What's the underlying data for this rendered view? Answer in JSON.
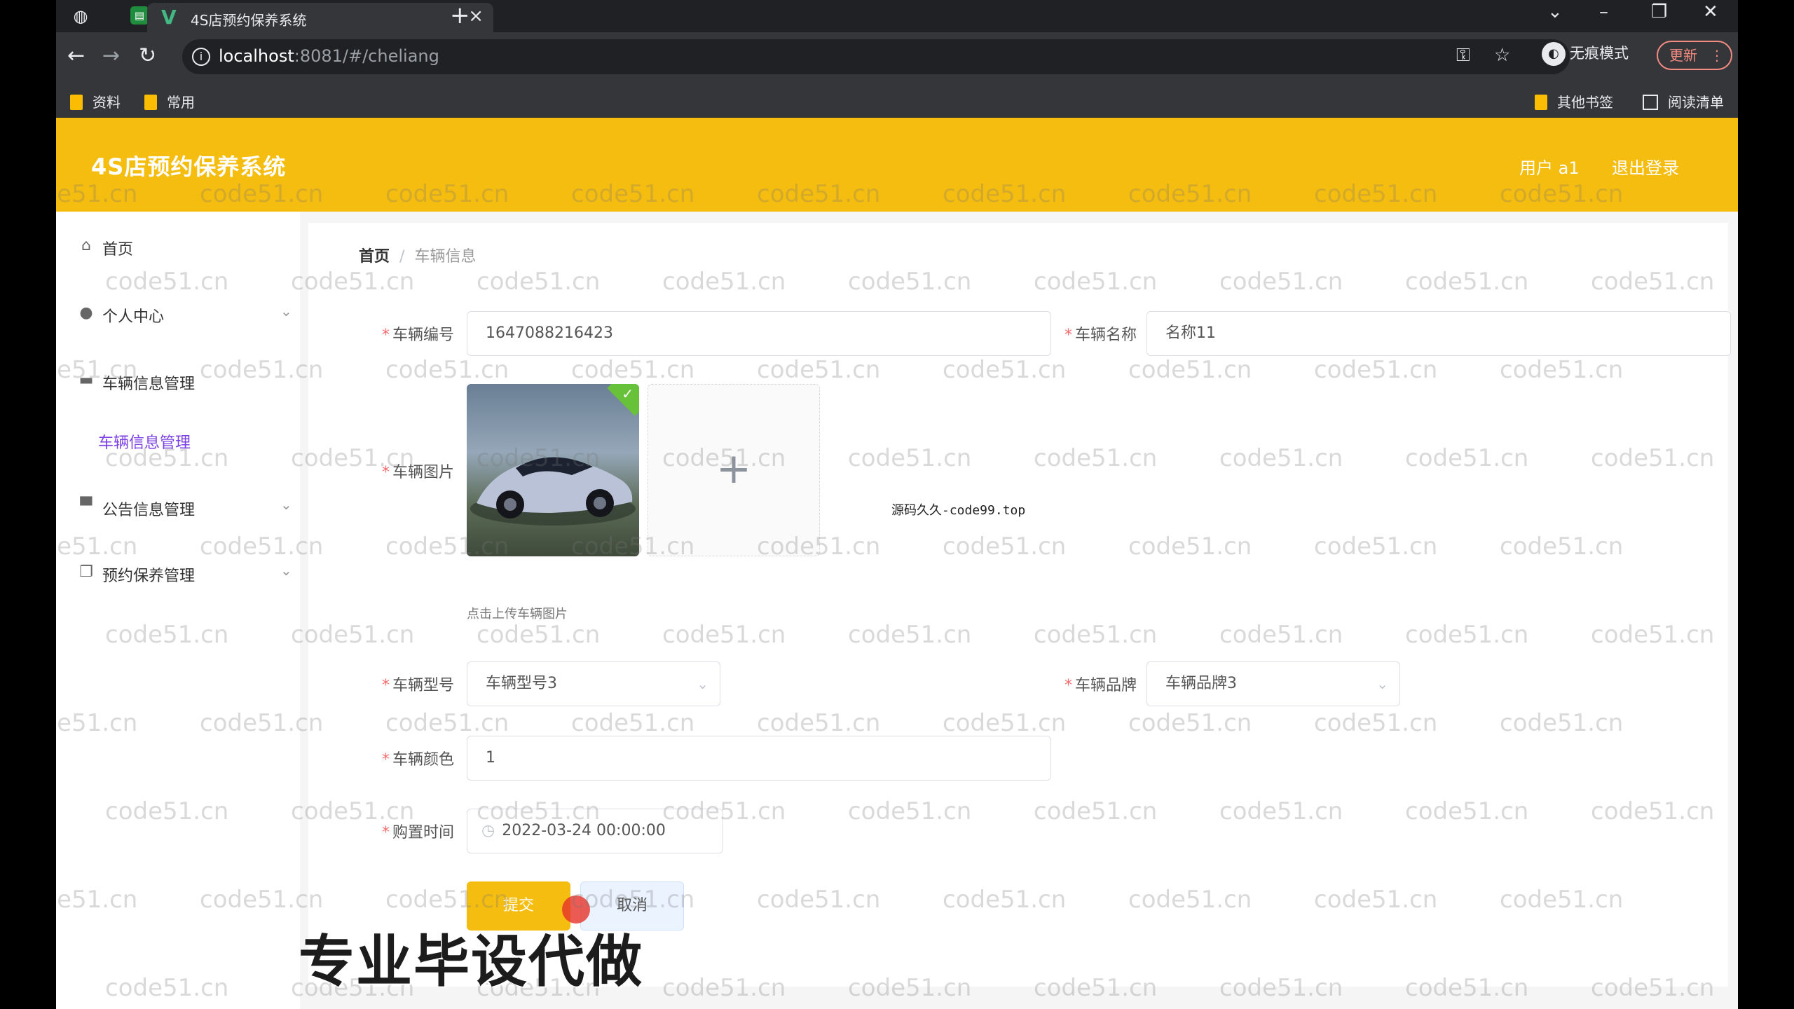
{
  "browser": {
    "tab_title": "4S店预约保养系统",
    "tab_close": "×",
    "new_tab": "+",
    "url_host": "localhost",
    "url_path": ":8081/#/cheliang",
    "incognito_label": "无痕模式",
    "update_label": "更新",
    "bookmarks": [
      "资料",
      "常用"
    ],
    "bookmarks_right": [
      "其他书签",
      "阅读清单"
    ]
  },
  "header": {
    "title": "4S店预约保养系统",
    "user": "用户 a1",
    "logout": "退出登录"
  },
  "sidebar": {
    "items": [
      {
        "label": "首页",
        "icon": "home-icon"
      },
      {
        "label": "个人中心",
        "icon": "user-icon"
      },
      {
        "label": "车辆信息管理",
        "icon": "car-icon"
      },
      {
        "label": "公告信息管理",
        "icon": "notice-icon"
      },
      {
        "label": "预约保养管理",
        "icon": "copy-icon"
      }
    ],
    "active_sub": "车辆信息管理"
  },
  "breadcrumb": {
    "home": "首页",
    "sep": "/",
    "current": "车辆信息"
  },
  "form": {
    "vehicle_no_label": "车辆编号",
    "vehicle_no_value": "1647088216423",
    "vehicle_name_label": "车辆名称",
    "vehicle_name_value": "名称11",
    "vehicle_image_label": "车辆图片",
    "upload_tip": "点击上传车辆图片",
    "vehicle_model_label": "车辆型号",
    "vehicle_model_value": "车辆型号3",
    "vehicle_brand_label": "车辆品牌",
    "vehicle_brand_value": "车辆品牌3",
    "vehicle_color_label": "车辆颜色",
    "vehicle_color_value": "1",
    "purchase_time_label": "购置时间",
    "purchase_time_value": "2022-03-24 00:00:00",
    "submit_label": "提交",
    "cancel_label": "取消"
  },
  "overlay": {
    "mid_note": "源码久久-code99.top",
    "ad_text": "专业毕设代做",
    "watermark": "code51.cn"
  }
}
